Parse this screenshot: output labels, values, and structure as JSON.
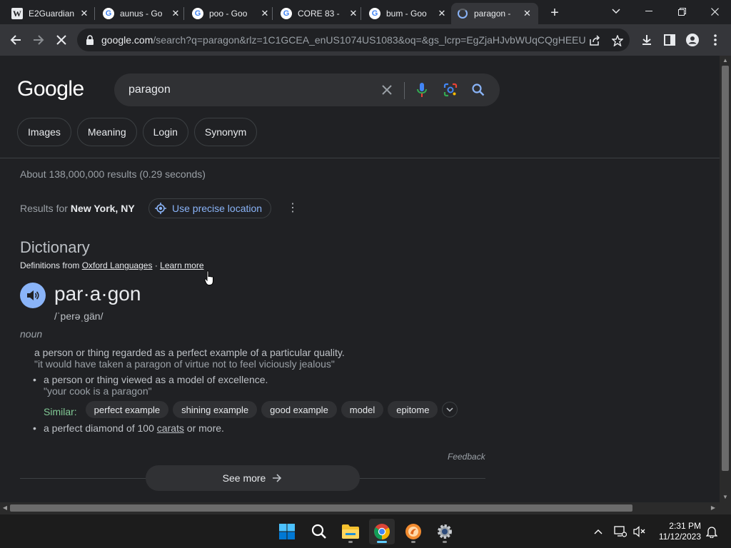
{
  "browser": {
    "tabs": [
      {
        "title": "E2Guardian",
        "favicon": "w-icon"
      },
      {
        "title": "aunus - Go",
        "favicon": "google-icon"
      },
      {
        "title": "poo - Goo",
        "favicon": "google-icon"
      },
      {
        "title": "CORE 83 -",
        "favicon": "google-icon"
      },
      {
        "title": "bum - Goo",
        "favicon": "google-icon"
      },
      {
        "title": "paragon -",
        "favicon": "loading-icon",
        "active": true
      }
    ],
    "url_host": "google.com",
    "url_rest": "/search?q=paragon&rlz=1C1GCEA_enUS1074US1083&oq=&gs_lcrp=EgZjaHJvbWUqCQgHEEU..."
  },
  "search": {
    "logo": "Google",
    "query": "paragon",
    "chips": [
      "Images",
      "Meaning",
      "Login",
      "Synonym"
    ],
    "stats": "About 138,000,000 results (0.29 seconds)",
    "results_for_label": "Results for",
    "location": "New York, NY",
    "precise_location": "Use precise location"
  },
  "dictionary": {
    "heading": "Dictionary",
    "defs_from_prefix": "Definitions from",
    "source": "Oxford Languages",
    "separator": "·",
    "learn_more": "Learn more",
    "word": "par·a·gon",
    "phonetic": "/ˈperəˌɡän/",
    "part_of_speech": "noun",
    "definition": "a person or thing regarded as a perfect example of a particular quality.",
    "example": "\"it would have taken a paragon of virtue not to feel viciously jealous\"",
    "sub_definition_1": "a person or thing viewed as a model of excellence.",
    "sub_example_1": "\"your cook is a paragon\"",
    "similar_label": "Similar:",
    "similar": [
      "perfect example",
      "shining example",
      "good example",
      "model",
      "epitome"
    ],
    "sub_definition_2_pre": "a perfect diamond of 100",
    "sub_definition_2_link": "carats",
    "sub_definition_2_post": "or more.",
    "feedback": "Feedback",
    "see_more": "See more"
  },
  "taskbar": {
    "time": "2:31 PM",
    "date": "11/12/2023"
  },
  "colors": {
    "accent_blue": "#8ab4f8",
    "similar_green": "#81c995",
    "background": "#202124"
  }
}
